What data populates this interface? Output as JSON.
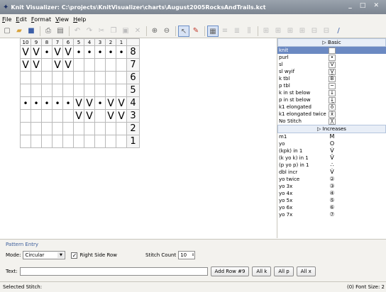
{
  "window": {
    "title": "Knit Visualizer: C:\\projects\\KnitVisualizer\\charts\\August2005RocksAndTrails.kct",
    "controls": "_ □ ✕"
  },
  "menu": [
    "File",
    "Edit",
    "Format",
    "View",
    "Help"
  ],
  "chart": {
    "columns": [
      "10",
      "9",
      "8",
      "7",
      "6",
      "5",
      "4",
      "3",
      "2",
      "1"
    ],
    "rows": [
      {
        "num": "8",
        "cells": [
          "V",
          "V",
          "•",
          "V",
          "V",
          "•",
          "•",
          "•",
          "•",
          "•"
        ]
      },
      {
        "num": "7",
        "cells": [
          "V",
          "V",
          "",
          "V",
          "V",
          "",
          "",
          "",
          "",
          ""
        ]
      },
      {
        "num": "6",
        "cells": [
          "",
          "",
          "",
          "",
          "",
          "",
          "",
          "",
          "",
          ""
        ]
      },
      {
        "num": "5",
        "cells": [
          "",
          "",
          "",
          "",
          "",
          "",
          "",
          "",
          "",
          ""
        ]
      },
      {
        "num": "4",
        "cells": [
          "•",
          "•",
          "•",
          "•",
          "•",
          "V",
          "V",
          "•",
          "V",
          "V"
        ]
      },
      {
        "num": "3",
        "cells": [
          "",
          "",
          "",
          "",
          "",
          "V",
          "V",
          "",
          "V",
          "V"
        ]
      },
      {
        "num": "2",
        "cells": [
          "",
          "",
          "",
          "",
          "",
          "",
          "",
          "",
          "",
          ""
        ]
      },
      {
        "num": "1",
        "cells": [
          "",
          "",
          "",
          "",
          "",
          "",
          "",
          "",
          "",
          ""
        ]
      }
    ]
  },
  "palette": {
    "basic_header": "▷ Basic",
    "basic": [
      {
        "label": "knit",
        "symbol": "",
        "selected": true
      },
      {
        "label": "purl",
        "symbol": "•"
      },
      {
        "label": "sl",
        "symbol": "V"
      },
      {
        "label": "sl wyif",
        "symbol": "V̲"
      },
      {
        "label": "k tbl",
        "symbol": "B"
      },
      {
        "label": "p tbl",
        "symbol": "~"
      },
      {
        "label": "k in st below",
        "symbol": "↓"
      },
      {
        "label": "p in st below",
        "symbol": "↓̲"
      },
      {
        "label": "k1 elongated",
        "symbol": "ŏ"
      },
      {
        "label": "k1 elongated twice",
        "symbol": "ẍ"
      },
      {
        "label": "No Stitch",
        "symbol": "╳"
      }
    ],
    "increases_header": "▷ Increases",
    "increases": [
      {
        "label": "m1",
        "symbol": "M"
      },
      {
        "label": "yo",
        "symbol": "O"
      },
      {
        "label": "(kpk) in 1",
        "symbol": "V̇"
      },
      {
        "label": "(k yo k) in 1",
        "symbol": "V̈"
      },
      {
        "label": "(p yo p) in 1",
        "symbol": "∴"
      },
      {
        "label": "dbl incr",
        "symbol": "V̇"
      },
      {
        "label": "yo twice",
        "symbol": "②"
      },
      {
        "label": "yo 3x",
        "symbol": "③"
      },
      {
        "label": "yo 4x",
        "symbol": "④"
      },
      {
        "label": "yo 5x",
        "symbol": "⑤"
      },
      {
        "label": "yo 6x",
        "symbol": "⑥"
      },
      {
        "label": "yo 7x",
        "symbol": "⑦"
      }
    ]
  },
  "pattern_entry": {
    "title": "Pattern Entry",
    "mode_label": "Mode:",
    "mode_value": "Circular",
    "right_side_label": "Right Side Row",
    "right_side_checked": "✓",
    "stitch_count_label": "Stitch Count",
    "stitch_count_value": "10",
    "text_label": "Text:",
    "text_value": "",
    "add_row_button": "Add Row #9",
    "all_k_button": "All k",
    "all_p_button": "All p",
    "all_x_button": "All x"
  },
  "status": {
    "selected_stitch_label": "Selected Stitch:",
    "right": "(0)   Font Size: 2"
  }
}
